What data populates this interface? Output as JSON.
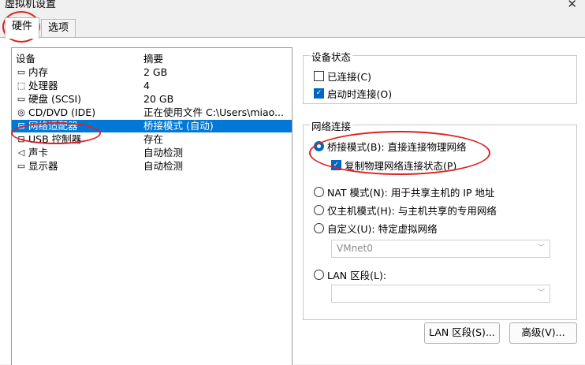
{
  "window": {
    "title": "虚拟机设置",
    "close_symbol": "✕"
  },
  "tabs": [
    {
      "label": "硬件",
      "active": true
    },
    {
      "label": "选项",
      "active": false
    }
  ],
  "device_list": {
    "headers": {
      "device": "设备",
      "summary": "摘要"
    },
    "rows": [
      {
        "icon": "memory-icon",
        "glyph": "▭",
        "name": "内存",
        "summary": "2 GB"
      },
      {
        "icon": "cpu-icon",
        "glyph": "⬚",
        "name": "处理器",
        "summary": "4"
      },
      {
        "icon": "disk-icon",
        "glyph": "▭",
        "name": "硬盘 (SCSI)",
        "summary": "20 GB"
      },
      {
        "icon": "cdrom-icon",
        "glyph": "◎",
        "name": "CD/DVD (IDE)",
        "summary": "正在使用文件 C:\\Users\\miao..."
      },
      {
        "icon": "network-adapter-icon",
        "glyph": "⊟",
        "name": "网络适配器",
        "summary": "桥接模式 (自动)",
        "selected": true
      },
      {
        "icon": "usb-icon",
        "glyph": "⊟",
        "name": "USB 控制器",
        "summary": "存在"
      },
      {
        "icon": "speaker-icon",
        "glyph": "◁",
        "name": "声卡",
        "summary": "自动检测"
      },
      {
        "icon": "monitor-icon",
        "glyph": "▭",
        "name": "显示器",
        "summary": "自动检测"
      }
    ]
  },
  "device_status": {
    "title": "设备状态",
    "connected": {
      "label": "已连接(C)",
      "checked": false
    },
    "connect_at_power_on": {
      "label": "启动时连接(O)",
      "checked": true
    }
  },
  "network_connection": {
    "title": "网络连接",
    "bridged": {
      "label": "桥接模式(B): 直接连接物理网络",
      "selected": true
    },
    "replicate": {
      "label": "复制物理网络连接状态(P)",
      "checked": true
    },
    "nat": {
      "label": "NAT 模式(N): 用于共享主机的 IP 地址",
      "selected": false
    },
    "host_only": {
      "label": "仅主机模式(H): 与主机共享的专用网络",
      "selected": false
    },
    "custom": {
      "label": "自定义(U): 特定虚拟网络",
      "selected": false
    },
    "custom_select_value": "VMnet0",
    "lan_segment": {
      "label": "LAN 区段(L):",
      "selected": false
    },
    "lan_select_value": ""
  },
  "buttons": {
    "lan_segments": "LAN 区段(S)...",
    "advanced": "高级(V)..."
  },
  "colors": {
    "selection": "#0078d7",
    "accent": "#0067c0",
    "annotation": "#e02020"
  }
}
